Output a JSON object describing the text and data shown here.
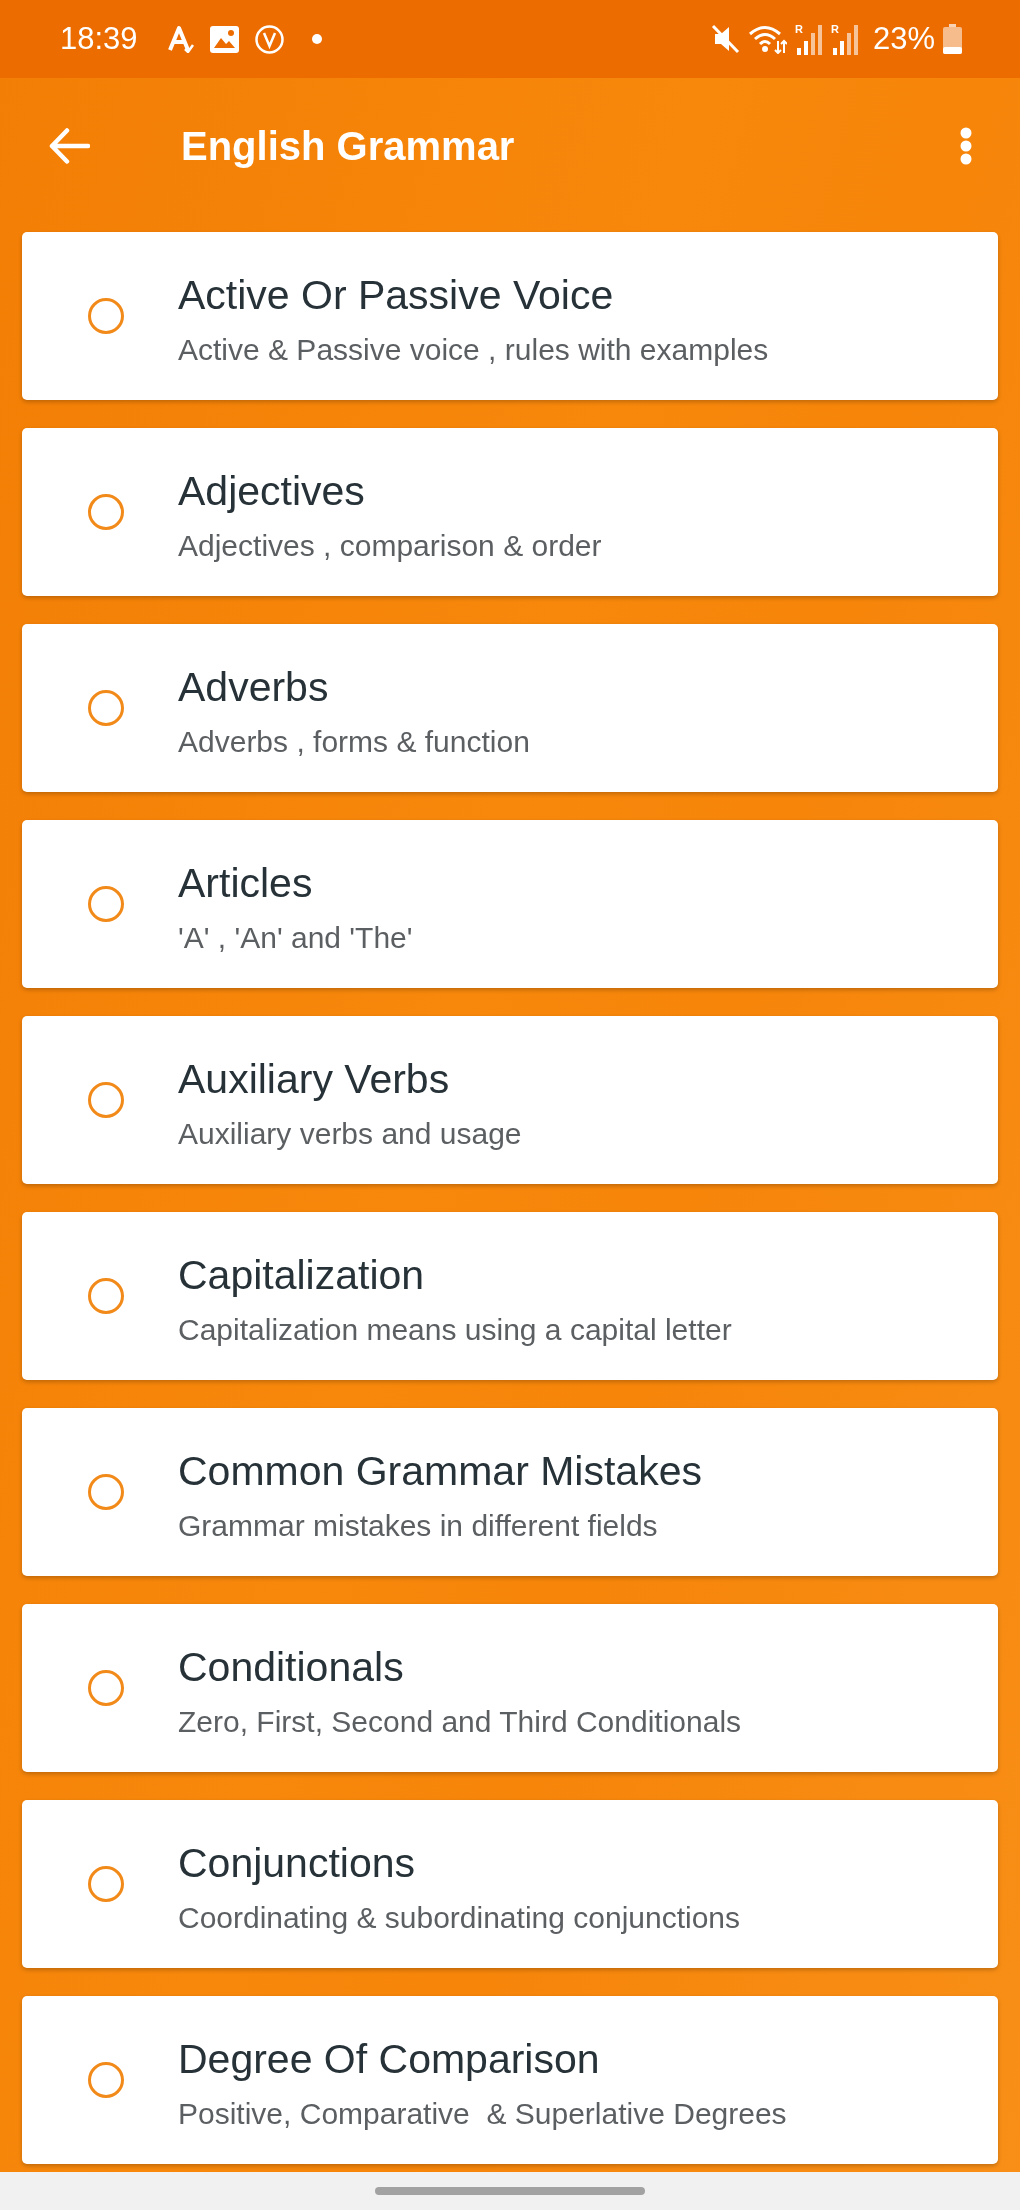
{
  "status_bar": {
    "time": "18:39",
    "signals": [
      {
        "label": "R"
      },
      {
        "label": "R"
      }
    ],
    "battery": "23%"
  },
  "app_bar": {
    "title": "English Grammar"
  },
  "topics": [
    {
      "title": "Active Or Passive Voice",
      "subtitle": "Active & Passive voice , rules with examples"
    },
    {
      "title": "Adjectives",
      "subtitle": "Adjectives , comparison & order"
    },
    {
      "title": "Adverbs",
      "subtitle": "Adverbs , forms & function"
    },
    {
      "title": "Articles",
      "subtitle": "'A' , 'An' and 'The'"
    },
    {
      "title": "Auxiliary Verbs",
      "subtitle": "Auxiliary verbs and usage"
    },
    {
      "title": "Capitalization",
      "subtitle": "Capitalization means using a capital letter"
    },
    {
      "title": "Common Grammar Mistakes",
      "subtitle": "Grammar mistakes in different fields"
    },
    {
      "title": "Conditionals",
      "subtitle": "Zero, First, Second and Third Conditionals"
    },
    {
      "title": "Conjunctions",
      "subtitle": "Coordinating & subordinating conjunctions"
    },
    {
      "title": "Degree Of Comparison",
      "subtitle": "Positive, Comparative  & Superlative Degrees"
    }
  ]
}
